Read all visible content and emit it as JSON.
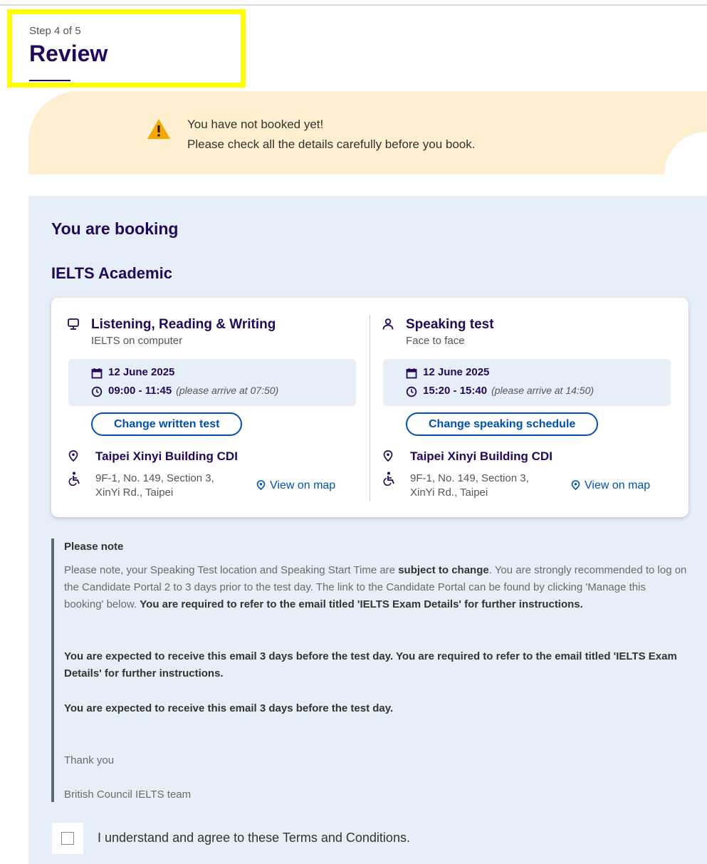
{
  "step": {
    "label": "Step 4 of 5",
    "title": "Review"
  },
  "warning": {
    "icon": "warning-triangle-icon",
    "line1": "You have not booked yet!",
    "line2": "Please check all the details carefully before you book.",
    "color": "#fdefcf"
  },
  "booking": {
    "heading": "You are booking",
    "product": "IELTS Academic",
    "written": {
      "icon": "computer-icon",
      "title": "Listening, Reading & Writing",
      "subtitle": "IELTS on computer",
      "date": "12 June 2025",
      "time": "09:00 - 11:45",
      "arrive": "(please arrive at 07:50)",
      "change_button": "Change written test",
      "venue": "Taipei Xinyi Building CDI",
      "address": "9F-1, No. 149, Section 3, XinYi Rd., Taipei",
      "map_link": "View on map"
    },
    "speaking": {
      "icon": "person-icon",
      "title": "Speaking test",
      "subtitle": "Face to face",
      "date": "12 June 2025",
      "time": "15:20 - 15:40",
      "arrive": "(please arrive at 14:50)",
      "change_button": "Change speaking schedule",
      "venue": "Taipei Xinyi Building CDI",
      "address": "9F-1, No. 149, Section 3, XinYi Rd., Taipei",
      "map_link": "View on map"
    }
  },
  "note": {
    "title": "Please note",
    "p1_a": "Please note, your Speaking Test location and Speaking Start Time are ",
    "p1_b": "subject to change",
    "p1_c": ". You are strongly recommended to log on the Candidate Portal 2 to 3 days prior to the test day. The link to the Candidate Portal can be found by clicking 'Manage this booking' below. ",
    "p1_d": "You are required to refer to the email titled 'IELTS Exam Details' for further instructions.",
    "p2": "You are expected to receive this email 3 days before the test day. You are required to refer to the email titled 'IELTS Exam Details' for further instructions.",
    "p3": "You are expected to receive this email 3 days before the test day.",
    "thanks": "Thank you",
    "team": "British Council IELTS team"
  },
  "agree": {
    "label": "I understand and agree to these Terms and Conditions.",
    "checked": false
  },
  "colors": {
    "brand": "#23085a",
    "link": "#0050b2",
    "panel": "#e6eef8",
    "highlight": "#ffff00"
  }
}
